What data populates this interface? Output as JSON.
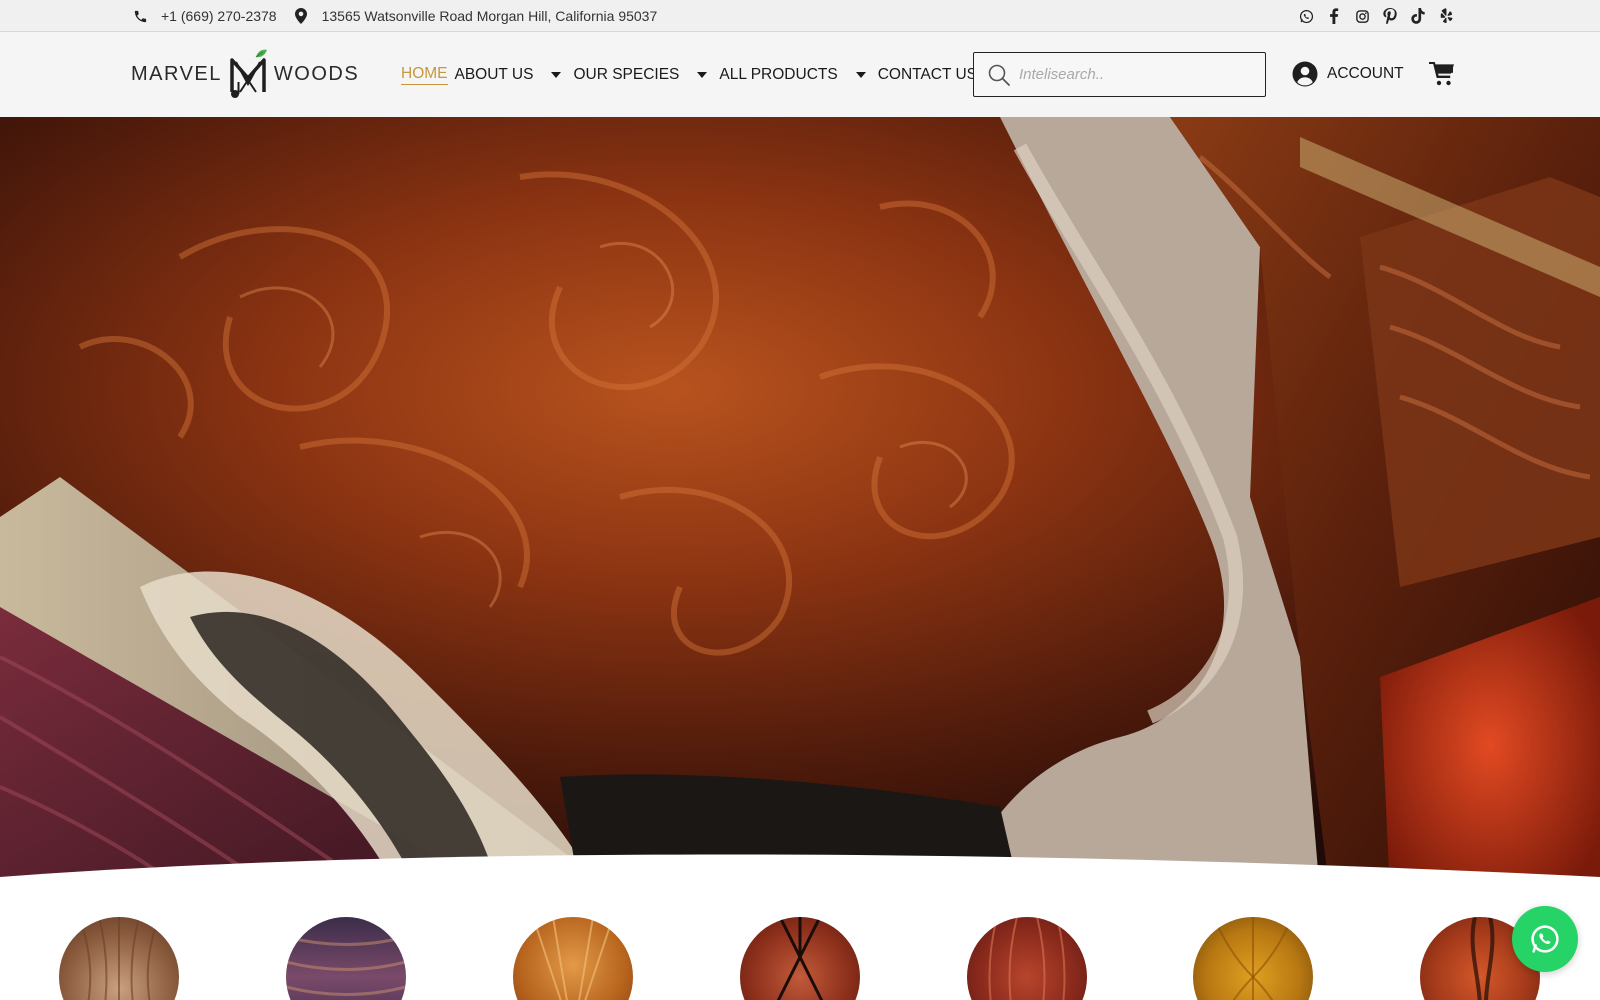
{
  "topbar": {
    "phone": "+1 (669) 270-2378",
    "address": "13565 Watsonville Road Morgan Hill, California 95037",
    "phone_icon": "phone-icon",
    "location_icon": "map-pin-icon",
    "social_icons": [
      "whatsapp-icon",
      "facebook-icon",
      "instagram-icon",
      "pinterest-icon",
      "tiktok-icon",
      "yelp-icon"
    ]
  },
  "header": {
    "logo": {
      "left": "MARVEL",
      "right": "WOODS"
    },
    "nav": {
      "home": "HOME",
      "about": "ABOUT US",
      "species": "OUR SPECIES",
      "products": "ALL PRODUCTS",
      "contact": "CONTACT US"
    },
    "search": {
      "placeholder": "Intelisearch.."
    },
    "account": "ACCOUNT",
    "cart_icon": "shopping-cart-icon"
  },
  "colors": {
    "accent": "#c8963c",
    "whatsapp": "#25d366",
    "topbar_bg": "#f0f0f0",
    "header_bg": "#f5f5f5"
  },
  "species_circles": [
    "wood-species-1",
    "wood-species-2",
    "wood-species-3",
    "wood-species-4",
    "wood-species-5",
    "wood-species-6",
    "wood-species-7"
  ],
  "floating": {
    "whatsapp_icon": "whatsapp-chat-icon"
  }
}
